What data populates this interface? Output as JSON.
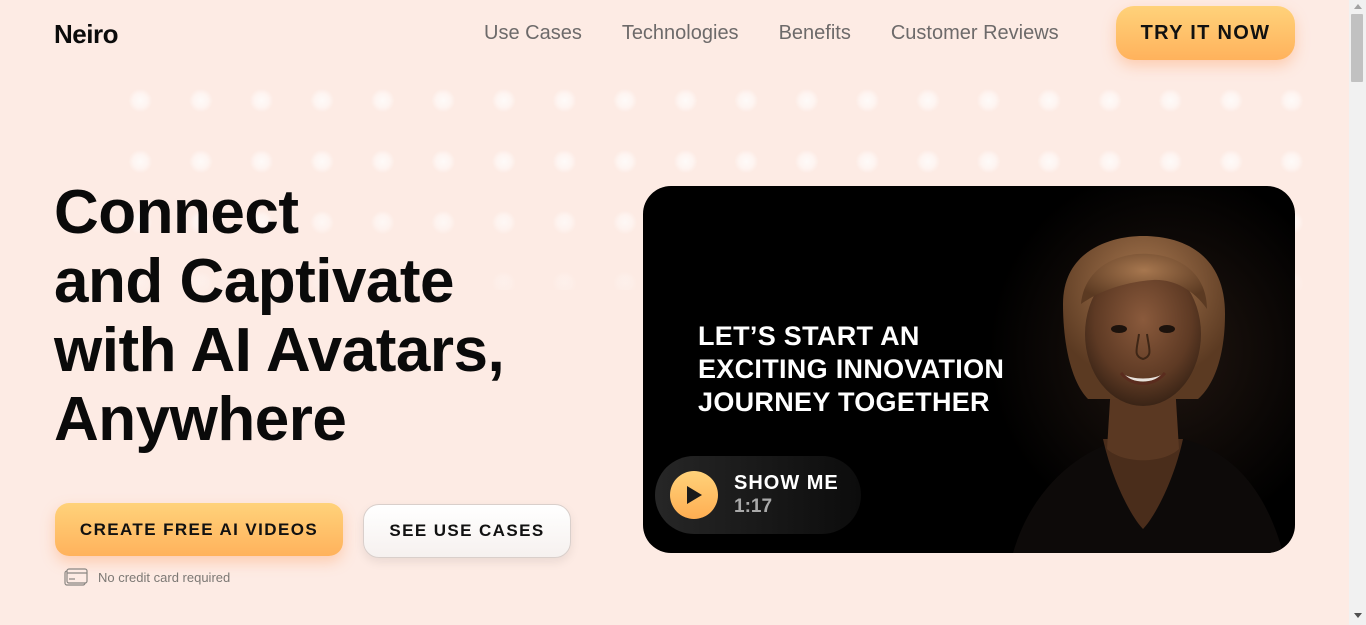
{
  "brand": {
    "logo": "Neiro"
  },
  "nav": {
    "links": [
      "Use Cases",
      "Technologies",
      "Benefits",
      "Customer Reviews"
    ],
    "cta": "TRY IT NOW"
  },
  "hero": {
    "title_lines": [
      "Connect",
      "and Captivate",
      "with AI Avatars,",
      "Anywhere"
    ],
    "primary_button": "CREATE FREE AI VIDEOS",
    "secondary_button": "SEE USE CASES",
    "note": "No credit card required"
  },
  "video": {
    "caption_lines": [
      "LET’S START AN",
      "EXCITING INNOVATION",
      "JOURNEY TOGETHER"
    ],
    "play_label": "SHOW ME",
    "duration": "1:17"
  },
  "colors": {
    "background": "#fdebe4",
    "accent_top": "#ffd27a",
    "accent_bottom": "#ffb25c",
    "video_bg": "#000000"
  }
}
